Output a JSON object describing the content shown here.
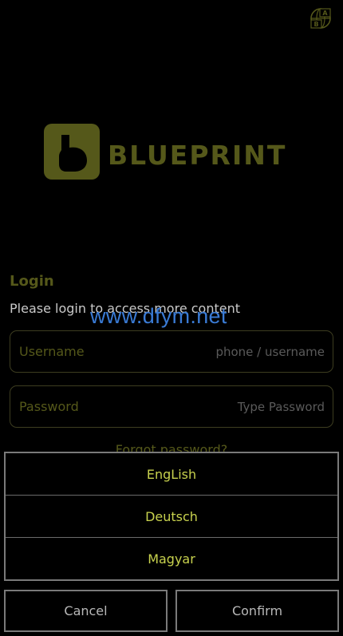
{
  "header": {
    "language_icon": "language-globe-icon"
  },
  "logo": {
    "brand": "BLUEPRINT",
    "color": "#55581a"
  },
  "login": {
    "title": "Login",
    "subtitle": "Please login to access more content",
    "username": {
      "label": "Username",
      "placeholder": "phone / username",
      "value": ""
    },
    "password": {
      "label": "Password",
      "placeholder": "Type Password",
      "value": ""
    },
    "forgot": "Forgot password?"
  },
  "watermark": "www.dfym.net",
  "language_picker": {
    "options": [
      "EngLish",
      "Deutsch",
      "Magyar"
    ],
    "cancel_label": "Cancel",
    "confirm_label": "Confirm"
  },
  "colors": {
    "accent": "#55581a",
    "option_text": "#c8d24e",
    "watermark": "#3a7bd5",
    "background": "#000000"
  }
}
